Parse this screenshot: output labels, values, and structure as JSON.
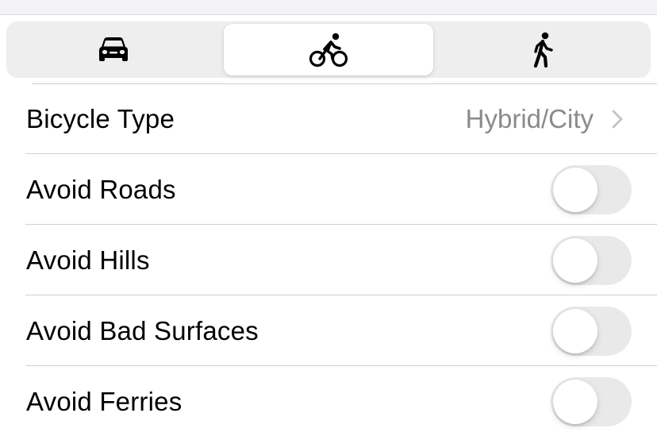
{
  "mode_tabs": [
    {
      "icon": "car-icon",
      "selected": false
    },
    {
      "icon": "bicycle-icon",
      "selected": true
    },
    {
      "icon": "walking-icon",
      "selected": false
    }
  ],
  "rows": {
    "bicycle_type": {
      "label": "Bicycle Type",
      "value": "Hybrid/City"
    },
    "avoid_roads": {
      "label": "Avoid Roads",
      "on": false
    },
    "avoid_hills": {
      "label": "Avoid Hills",
      "on": false
    },
    "avoid_bad_surfaces": {
      "label": "Avoid Bad Surfaces",
      "on": false
    },
    "avoid_ferries": {
      "label": "Avoid Ferries",
      "on": false
    }
  },
  "colors": {
    "background": "#ffffff",
    "segment_background": "#eeeeef",
    "toggle_off": "#e9e9ea",
    "secondary_text": "#8a8a8e",
    "separator": "#d1d1d6"
  }
}
